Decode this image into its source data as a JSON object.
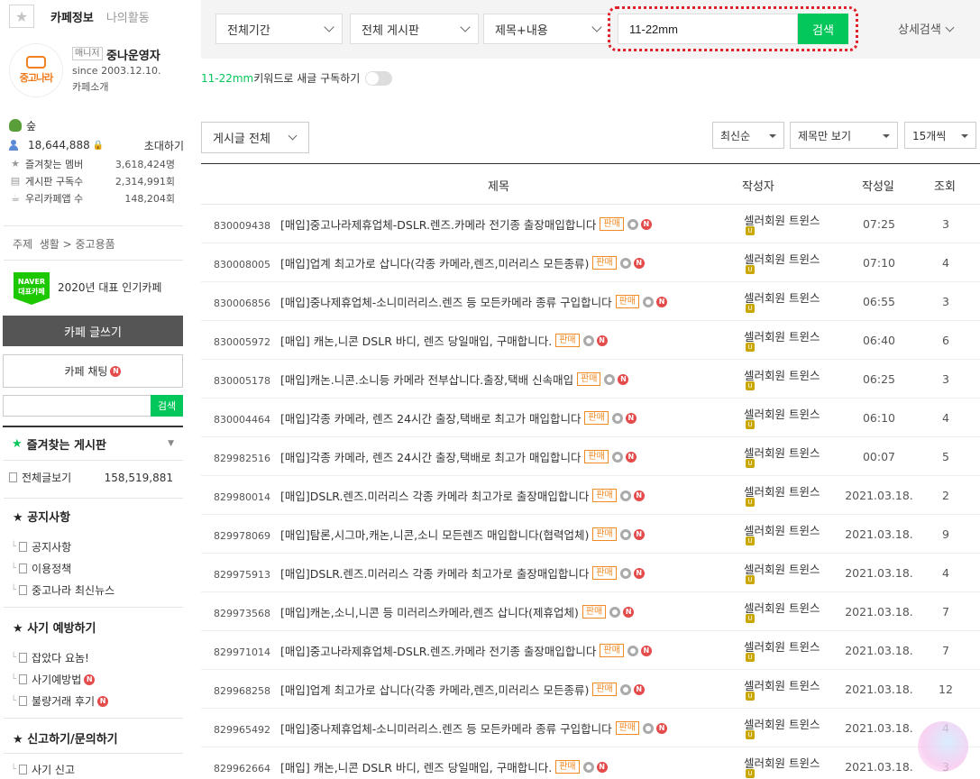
{
  "sidebar": {
    "tab_cafe_info": "카페정보",
    "tab_my_activity": "나의활동",
    "logo_text": "중고나라",
    "manager_tag": "매니저",
    "operator_name": "중나운영자",
    "since": "since 2003.12.10.",
    "intro": "카페소개",
    "level_name": "숲",
    "member_count": "18,644,888",
    "invite": "초대하기",
    "stats": [
      {
        "icon": "★",
        "label": "즐겨찾는 멤버",
        "value": "3,618,424명"
      },
      {
        "icon": "▤",
        "label": "게시판 구독수",
        "value": "2,314,991회"
      },
      {
        "icon": "☕",
        "label": "우리카페앱 수",
        "value": "148,204회"
      }
    ],
    "topic_label": "주제",
    "topic_value": "생활 > 중고용품",
    "naver_badge": "NAVER 대표카페",
    "popular": "2020년 대표 인기카페",
    "write_btn": "카페 글쓰기",
    "chat_btn": "카페 채팅",
    "search_btn": "검색",
    "fav_board": "즐겨찾는 게시판",
    "all_posts": "전체글보기",
    "all_posts_count": "158,519,881",
    "menus": [
      {
        "head": "공지사항",
        "items": [
          "공지사항",
          "이용정책",
          "중고나라 최신뉴스"
        ]
      },
      {
        "head": "사기 예방하기",
        "items": [
          "잡았다 요놈!",
          "사기예방법",
          "불량거래 후기"
        ]
      },
      {
        "head": "신고하기/문의하기",
        "items": [
          "사기 신고"
        ]
      }
    ]
  },
  "search": {
    "period": "전체기간",
    "board": "전체 게시판",
    "scope": "제목+내용",
    "query": "11-22mm",
    "button": "검색",
    "detail": "상세검색"
  },
  "subscribe": {
    "keyword": "11-22mm",
    "text": " 키워드로 새글 구독하기"
  },
  "filters": {
    "post_type": "게시글 전체",
    "sort": "최신순",
    "view": "제목만 보기",
    "per_page": "15개씩"
  },
  "table": {
    "headers": {
      "title": "제목",
      "author": "작성자",
      "date": "작성일",
      "views": "조회"
    },
    "badge": "판매",
    "rows": [
      {
        "num": "830009438",
        "title": "[매입]중고나라제휴업체-DSLR.렌즈.카메라 전기종 출장매입합니다",
        "author": "셀러회원 트윈스",
        "date": "07:25",
        "views": "3"
      },
      {
        "num": "830008005",
        "title": "[매입]업계 최고가로 삽니다(각종 카메라,렌즈,미러리스 모든종류)",
        "author": "셀러회원 트윈스",
        "date": "07:10",
        "views": "4"
      },
      {
        "num": "830006856",
        "title": "[매입]중나제휴업체-소니미러리스.렌즈 등 모든카메라 종류 구입합니다",
        "author": "셀러회원 트윈스",
        "date": "06:55",
        "views": "3"
      },
      {
        "num": "830005972",
        "title": "[매입] 캐논,니콘 DSLR 바디, 렌즈 당일매입, 구매합니다.",
        "author": "셀러회원 트윈스",
        "date": "06:40",
        "views": "6"
      },
      {
        "num": "830005178",
        "title": "[매입]캐논.니콘.소니등 카메라 전부삽니다.출장,택배 신속매입",
        "author": "셀러회원 트윈스",
        "date": "06:25",
        "views": "3"
      },
      {
        "num": "830004464",
        "title": "[매입]각종 카메라, 렌즈 24시간 출장,택배로 최고가 매입합니다",
        "author": "셀러회원 트윈스",
        "date": "06:10",
        "views": "4"
      },
      {
        "num": "829982516",
        "title": "[매입]각종 카메라, 렌즈 24시간 출장,택배로 최고가 매입합니다",
        "author": "셀러회원 트윈스",
        "date": "00:07",
        "views": "5"
      },
      {
        "num": "829980014",
        "title": "[매입]DSLR.렌즈.미러리스 각종 카메라 최고가로 출장매입합니다",
        "author": "셀러회원 트윈스",
        "date": "2021.03.18.",
        "views": "2"
      },
      {
        "num": "829978069",
        "title": "[매입]탐론,시그마,캐논,니콘,소니 모든렌즈 매입합니다(협력업체)",
        "author": "셀러회원 트윈스",
        "date": "2021.03.18.",
        "views": "9"
      },
      {
        "num": "829975913",
        "title": "[매입]DSLR.렌즈.미러리스 각종 카메라 최고가로 출장매입합니다",
        "author": "셀러회원 트윈스",
        "date": "2021.03.18.",
        "views": "4"
      },
      {
        "num": "829973568",
        "title": "[매입]캐논,소니,니콘 등 미러리스카메라,렌즈 삽니다(제휴업체)",
        "author": "셀러회원 트윈스",
        "date": "2021.03.18.",
        "views": "7"
      },
      {
        "num": "829971014",
        "title": "[매입]중고나라제휴업체-DSLR.렌즈.카메라 전기종 출장매입합니다",
        "author": "셀러회원 트윈스",
        "date": "2021.03.18.",
        "views": "7"
      },
      {
        "num": "829968258",
        "title": "[매입]업계 최고가로 삽니다(각종 카메라,렌즈,미러리스 모든종류)",
        "author": "셀러회원 트윈스",
        "date": "2021.03.18.",
        "views": "12"
      },
      {
        "num": "829965492",
        "title": "[매입]중나제휴업체-소니미러리스.렌즈 등 모든카메라 종류 구입합니다",
        "author": "셀러회원 트윈스",
        "date": "2021.03.18.",
        "views": "4"
      },
      {
        "num": "829962664",
        "title": "[매입] 캐논,니콘 DSLR 바디, 렌즈 당일매입, 구매합니다.",
        "author": "셀러회원 트윈스",
        "date": "2021.03.18.",
        "views": "3"
      }
    ]
  },
  "colors": {
    "accent": "#03c75a",
    "badge": "#f08a24",
    "highlight": "#e0202a"
  }
}
